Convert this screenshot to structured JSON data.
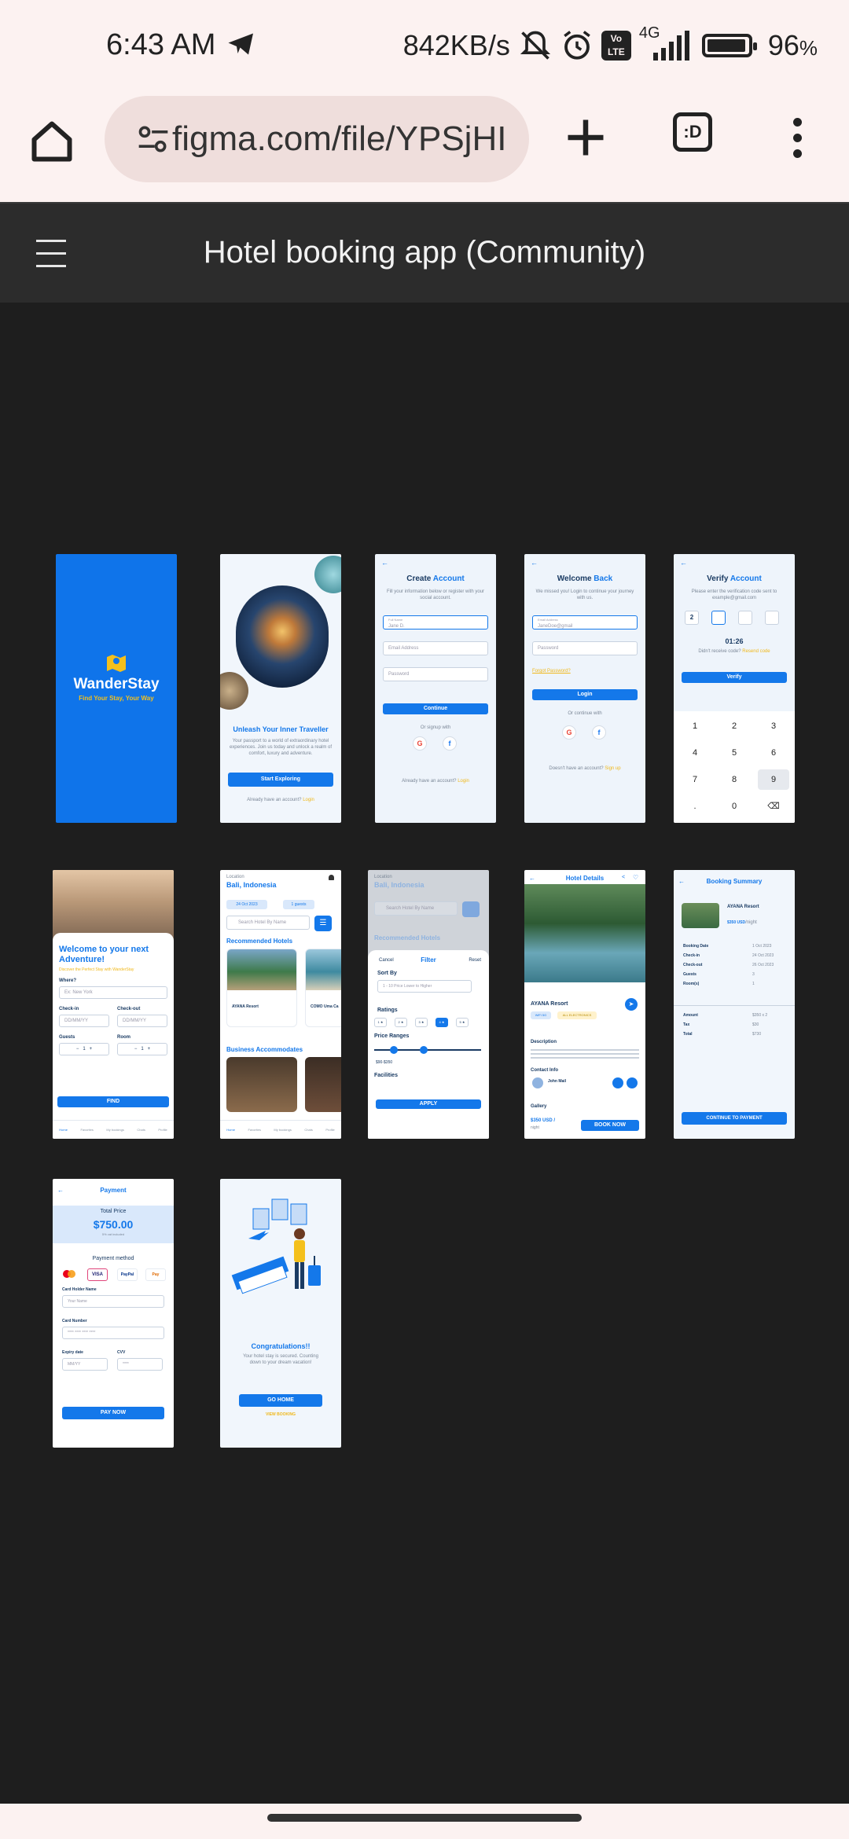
{
  "status": {
    "time": "6:43 AM",
    "net_speed": "842KB/s",
    "net_type": "4G",
    "volte": "Vo LTE",
    "battery": "96",
    "battery_unit": "%",
    "battery_level": 0.96
  },
  "browser": {
    "url": "figma.com/file/YPSjHI",
    "tabs_label": ":D"
  },
  "figma": {
    "file_title": "Hotel booking app (Community)"
  },
  "screens": {
    "splash": {
      "brand": "WanderStay",
      "tagline": "Find Your Stay, Your Way"
    },
    "onboard": {
      "title": "Unleash Your Inner Traveller",
      "body": "Your passport to a world of extraordinary hotel experiences. Join us today and unlock a realm of comfort, luxury and adventure.",
      "cta": "Start Exploring",
      "login_text": "Already have an account?",
      "login_link": "Login"
    },
    "create": {
      "title_a": "Create ",
      "title_b": "Account",
      "sub": "Fill your information below or register with your social account.",
      "name_label": "Full Name",
      "name_value": "Jane D.",
      "email": "Email Address",
      "password": "Password",
      "cta": "Continue",
      "or": "Or signup with",
      "footer": "Already have an account?",
      "footer_link": "Login"
    },
    "welcome": {
      "title_a": "Welcome ",
      "title_b": "Back",
      "sub": "We missed you! Login to continue your journey with us.",
      "email_label": "Email Address",
      "email_value": "JaneDoe@gmail",
      "password": "Password",
      "forgot": "Forgot Password?",
      "cta": "Login",
      "or": "Or continue with",
      "footer": "Doesn't have an account?",
      "footer_link": "Sign up"
    },
    "verify": {
      "title_a": "Verify ",
      "title_b": "Account",
      "sub": "Please enter the verification code sent to example@gmail.com",
      "code_first": "2",
      "timer": "01:26",
      "resend": "Didn't receive code?",
      "resend_link": "Resend code",
      "cta": "Verify",
      "keys": [
        "1",
        "2",
        "3",
        "4",
        "5",
        "6",
        "7",
        "8",
        "9",
        ".",
        "0",
        "⌫"
      ]
    },
    "adventure": {
      "title": "Welcome to your next Adventure!",
      "sub": "Discover the Perfect Stay with WanderStay",
      "where": "Where?",
      "where_ph": "Ex: New York",
      "checkin": "Check-in",
      "checkout": "Check-out",
      "date_ph": "DD/MM/YY",
      "guests": "Guests",
      "room": "Room",
      "count": "1",
      "cta": "FIND",
      "nav": [
        "Home",
        "Favorites",
        "My bookings",
        "Chats",
        "Profile"
      ]
    },
    "home": {
      "location_label": "Location",
      "location": "Bali, Indonesia",
      "date_chip": "24 Oct 2023",
      "guest_chip": "1 guests",
      "search_ph": "Search Hotel By Name",
      "rec": "Recommended Hotels",
      "hotel1": "AYANA Resort",
      "hotel2": "COMO Uma Ca",
      "business": "Business Accommodates",
      "nav": [
        "Home",
        "Favorites",
        "My bookings",
        "Chats",
        "Profile"
      ]
    },
    "filter": {
      "location_label": "Location",
      "location": "Bali, Indonesia",
      "search_ph": "Search Hotel By Name",
      "rec": "Recommended Hotels",
      "cancel": "Cancel",
      "title": "Filter",
      "reset": "Reset",
      "sort_by": "Sort By",
      "sort_value": "1 - 10  Price Lower to Higher",
      "ratings": "Ratings",
      "rating_opts": [
        "1 ★",
        "2 ★",
        "3 ★",
        "4 ★",
        "5 ★"
      ],
      "price_range": "Price Ranges",
      "price_value": "$90-$350",
      "facilities": "Facilities",
      "cta": "APPLY"
    },
    "details": {
      "title": "Hotel Details",
      "name": "AYANA Resort",
      "chip1": "WiFi 5G",
      "chip2": "ALL ELECTRONICS",
      "desc_h": "Description",
      "contact_h": "Contact Info",
      "contact_name": "John Mail",
      "gallery_h": "Gallery",
      "price": "$350 USD /",
      "per": "night",
      "cta": "BOOK NOW"
    },
    "summary": {
      "title": "Booking Summary",
      "hotel": "AYANA Resort",
      "price": "$350 USD",
      "per": "/night",
      "rows": [
        [
          "Booking Date",
          "1 Oct 2023"
        ],
        [
          "Check-in",
          "24 Oct 2023"
        ],
        [
          "Check-out",
          "26 Oct 2023"
        ],
        [
          "Guests",
          "3"
        ],
        [
          "Room(s)",
          "1"
        ]
      ],
      "totals": [
        [
          "Amount",
          "$350 x 2"
        ],
        [
          "Tax",
          "$30"
        ],
        [
          "Total",
          "$730"
        ]
      ],
      "cta": "CONTINUE TO PAYMENT"
    },
    "payment": {
      "title": "Payment",
      "total_label": "Total Price",
      "total": "$750.00",
      "tax_note": "5% vat included",
      "method": "Payment method",
      "card_name_label": "Card Holder Name",
      "card_name_ph": "Your Name",
      "card_number_label": "Card Number",
      "card_number_ph": "**** **** **** ****",
      "expiry_label": "Expiry date",
      "expiry_ph": "MM/YY",
      "cvv_label": "CVV",
      "cvv_ph": "****",
      "cta": "PAY NOW",
      "brands": [
        "VISA",
        "PayPal",
        "Pay"
      ]
    },
    "congrats": {
      "title": "Congratulations!!",
      "body": "Your hotel stay is secured. Counting down to your dream vacation!",
      "cta": "GO HOME",
      "link": "VIEW BOOKING"
    }
  }
}
